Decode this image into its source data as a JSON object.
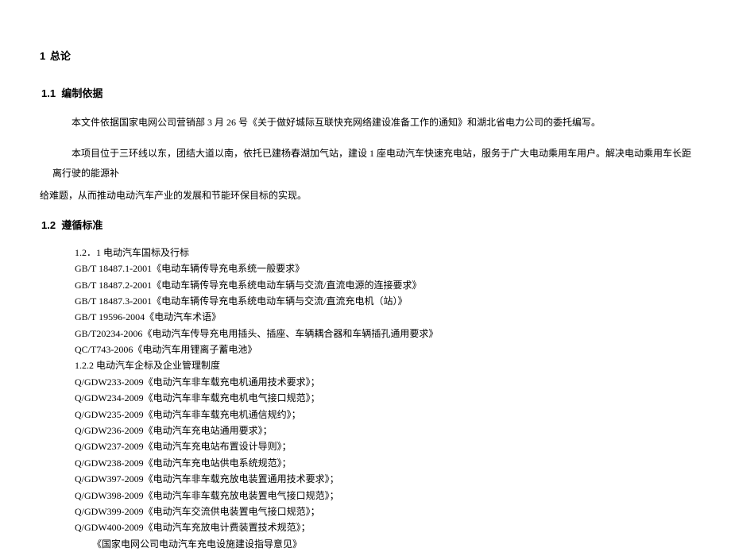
{
  "section1": {
    "num": "1",
    "title": "总论"
  },
  "section11": {
    "num": "1.1",
    "title": "编制依据",
    "para1": "本文件依据国家电网公司营销部 3 月 26 号《关于做好城际互联快充网络建设准备工作的通知》和湖北省电力公司的委托编写。",
    "para2": "本项目位于三环线以东，团结大道以南，依托已建杨春湖加气站，建设 1 座电动汽车快速充电站，服务于广大电动乘用车用户。解决电动乘用车长距离行驶的能源补",
    "para3": "给难题，从而推动电动汽车产业的发展和节能环保目标的实现。"
  },
  "section12": {
    "num": "1.2",
    "title": "遵循标准",
    "sub1": "1.2．1 电动汽车国标及行标",
    "items1": [
      "GB/T 18487.1-2001《电动车辆传导充电系统一般要求》",
      "GB/T 18487.2-2001《电动车辆传导充电系统电动车辆与交流/直流电源的连接要求》",
      "GB/T 18487.3-2001《电动车辆传导充电系统电动车辆与交流/直流充电机（站）》",
      "GB/T 19596-2004《电动汽车术语》",
      "GB/T20234-2006《电动汽车传导充电用插头、插座、车辆耦合器和车辆插孔通用要求》",
      "QC/T743-2006《电动汽车用锂离子蓄电池》"
    ],
    "sub2": "1.2.2 电动汽车企标及企业管理制度",
    "items2": [
      "Q/GDW233-2009《电动汽车非车载充电机通用技术要求》；",
      "Q/GDW234-2009《电动汽车非车载充电机电气接口规范》；",
      "Q/GDW235-2009《电动汽车非车载充电机通信规约》；",
      "Q/GDW236-2009《电动汽车充电站通用要求》；",
      "Q/GDW237-2009《电动汽车充电站布置设计导则》；",
      "Q/GDW238-2009《电动汽车充电站供电系统规范》；",
      "Q/GDW397-2009《电动汽车非车载充放电装置通用技术要求》；",
      "Q/GDW398-2009《电动汽车非车载充放电装置电气接口规范》；",
      "Q/GDW399-2009《电动汽车交流供电装置电气接口规范》；",
      "Q/GDW400-2009《电动汽车充放电计费装置技术规范》；"
    ],
    "final": "《国家电网公司电动汽车充电设施建设指导意见》"
  }
}
